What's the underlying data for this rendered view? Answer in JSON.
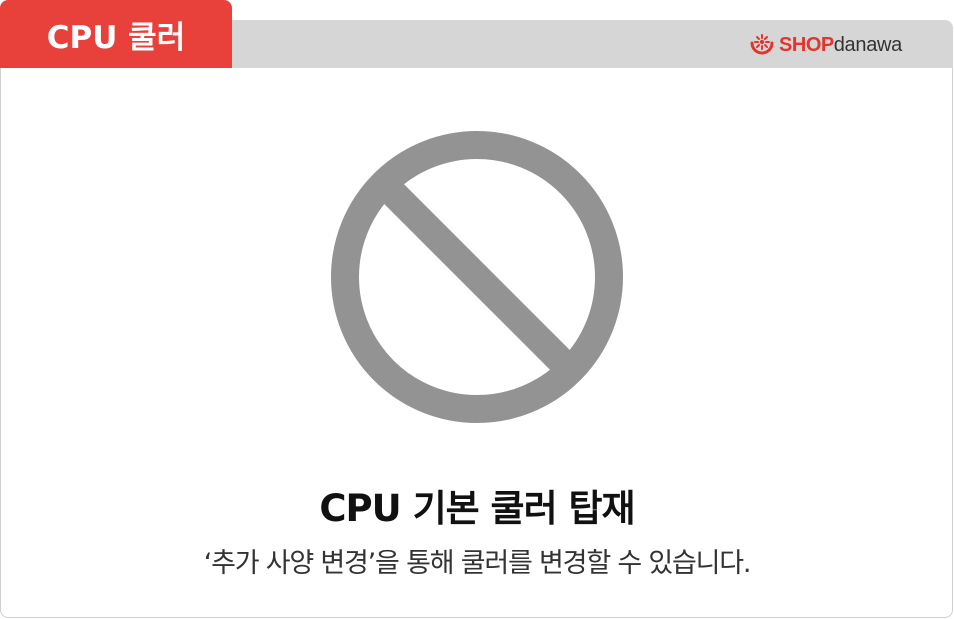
{
  "tab": {
    "label": "CPU 쿨러"
  },
  "logo": {
    "shop": "SHOP",
    "danawa": "danawa",
    "icon": "danawa-logo-icon"
  },
  "status": {
    "icon": "prohibited-icon",
    "title": "CPU 기본 쿨러 탑재",
    "description": "‘추가 사양 변경’을 통해 쿨러를 변경할 수 있습니다."
  },
  "colors": {
    "accent": "#e8403a",
    "header_bg": "#d6d6d6",
    "icon_gray": "#939393"
  }
}
